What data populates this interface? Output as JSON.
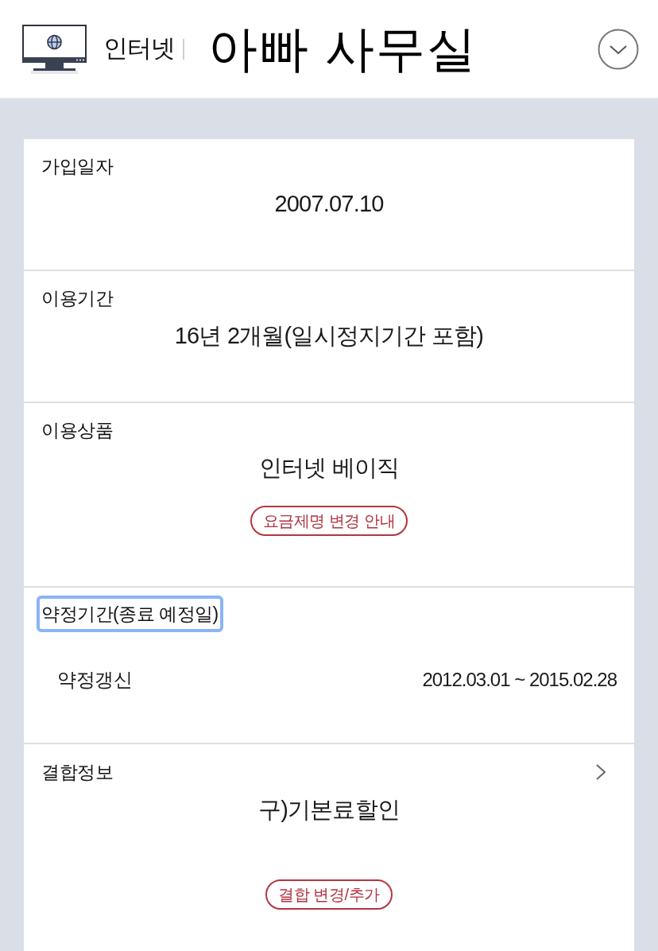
{
  "header": {
    "service": "인터넷",
    "title": "아빠 사무실"
  },
  "sections": [
    {
      "kind": "value",
      "label": "가입일자",
      "focused": false,
      "value": "2007.07.10"
    },
    {
      "kind": "value",
      "label": "이용기간",
      "focused": false,
      "value": "16년 2개월(일시정지기간 포함)"
    },
    {
      "kind": "value",
      "label": "이용상품",
      "focused": false,
      "value": "인터넷 베이직",
      "action": "요금제명 변경 안내"
    },
    {
      "kind": "pair",
      "label": "약정기간(종료 예정일)",
      "focused": true,
      "row": {
        "name": "약정갱신",
        "period": "2012.03.01 ~ 2015.02.28"
      }
    },
    {
      "kind": "link",
      "label": "결합정보",
      "focused": false,
      "value": "구)기본료할인",
      "action": "결합 변경/추가"
    }
  ]
}
